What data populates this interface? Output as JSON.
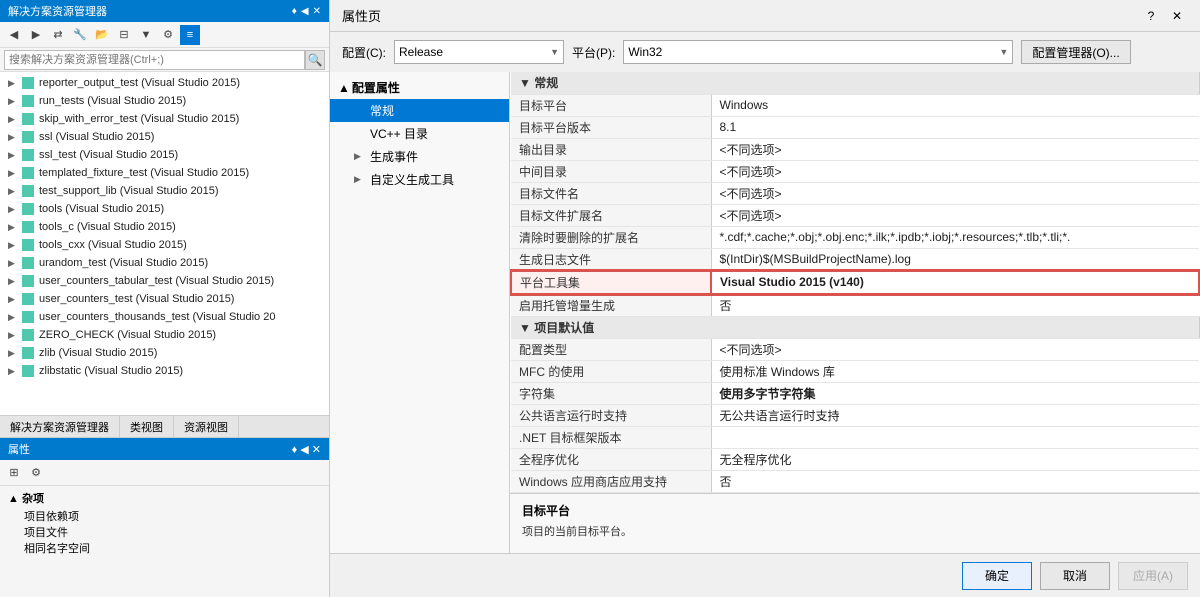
{
  "leftPanel": {
    "title": "解决方案资源管理器",
    "pinLabel": "♦",
    "autoHideLabel": "◀",
    "closeLabel": "✕",
    "searchPlaceholder": "搜索解决方案资源管理器(Ctrl+;)",
    "treeItems": [
      {
        "label": "reporter_output_test (Visual Studio 2015)",
        "indent": 0,
        "hasExpander": true,
        "expanded": false
      },
      {
        "label": "run_tests (Visual Studio 2015)",
        "indent": 0,
        "hasExpander": true,
        "expanded": false
      },
      {
        "label": "skip_with_error_test (Visual Studio 2015)",
        "indent": 0,
        "hasExpander": true,
        "expanded": false
      },
      {
        "label": "ssl (Visual Studio 2015)",
        "indent": 0,
        "hasExpander": true,
        "expanded": false
      },
      {
        "label": "ssl_test (Visual Studio 2015)",
        "indent": 0,
        "hasExpander": true,
        "expanded": false
      },
      {
        "label": "templated_fixture_test (Visual Studio 2015)",
        "indent": 0,
        "hasExpander": true,
        "expanded": false
      },
      {
        "label": "test_support_lib (Visual Studio 2015)",
        "indent": 0,
        "hasExpander": true,
        "expanded": false
      },
      {
        "label": "tools (Visual Studio 2015)",
        "indent": 0,
        "hasExpander": true,
        "expanded": false
      },
      {
        "label": "tools_c (Visual Studio 2015)",
        "indent": 0,
        "hasExpander": true,
        "expanded": false
      },
      {
        "label": "tools_cxx (Visual Studio 2015)",
        "indent": 0,
        "hasExpander": true,
        "expanded": false
      },
      {
        "label": "urandom_test (Visual Studio 2015)",
        "indent": 0,
        "hasExpander": true,
        "expanded": false
      },
      {
        "label": "user_counters_tabular_test (Visual Studio 2015)",
        "indent": 0,
        "hasExpander": true,
        "expanded": false
      },
      {
        "label": "user_counters_test (Visual Studio 2015)",
        "indent": 0,
        "hasExpander": true,
        "expanded": false
      },
      {
        "label": "user_counters_thousands_test (Visual Studio 20",
        "indent": 0,
        "hasExpander": true,
        "expanded": false
      },
      {
        "label": "ZERO_CHECK (Visual Studio 2015)",
        "indent": 0,
        "hasExpander": true,
        "expanded": false
      },
      {
        "label": "zlib (Visual Studio 2015)",
        "indent": 0,
        "hasExpander": true,
        "expanded": false
      },
      {
        "label": "zlibstatic (Visual Studio 2015)",
        "indent": 0,
        "hasExpander": true,
        "expanded": false
      }
    ],
    "bottomTabs": [
      "解决方案资源管理器",
      "类视图",
      "资源视图"
    ],
    "propertiesTitle": "属性",
    "propToolbarBtns": [
      "⊞",
      "⚙"
    ],
    "propSections": [
      {
        "label": "杂项",
        "items": [
          "项目依赖项",
          "项目文件",
          "相同名字空间"
        ]
      }
    ]
  },
  "dialog": {
    "title": "属性页",
    "helpLabel": "?",
    "closeLabel": "✕",
    "configLabel": "配置(C):",
    "configValue": "Release",
    "platformLabel": "平台(P):",
    "platformValue": "Win32",
    "configMgrLabel": "配置管理器(O)...",
    "configTree": [
      {
        "label": "▲ 配置属性",
        "isSection": true,
        "expanded": true
      },
      {
        "label": "常规",
        "indent": 1,
        "selected": true
      },
      {
        "label": "VC++ 目录",
        "indent": 1,
        "selected": false
      },
      {
        "label": "▶ 生成事件",
        "indent": 1,
        "hasExpander": true,
        "selected": false
      },
      {
        "label": "▶ 自定义生成工具",
        "indent": 1,
        "hasExpander": true,
        "selected": false
      }
    ],
    "sections": [
      {
        "label": "▼ 常规",
        "isHeader": true,
        "rows": [
          {
            "name": "目标平台",
            "value": "Windows",
            "valueClass": "gray-text",
            "highlighted": false
          },
          {
            "name": "目标平台版本",
            "value": "8.1",
            "valueClass": "",
            "highlighted": false
          },
          {
            "name": "输出目录",
            "value": "<不同选项>",
            "valueClass": "gray-text",
            "highlighted": false
          },
          {
            "name": "中间目录",
            "value": "<不同选项>",
            "valueClass": "gray-text",
            "highlighted": false
          },
          {
            "name": "目标文件名",
            "value": "<不同选项>",
            "valueClass": "gray-text",
            "highlighted": false
          },
          {
            "name": "目标文件扩展名",
            "value": "<不同选项>",
            "valueClass": "gray-text",
            "highlighted": false
          },
          {
            "name": "清除时要删除的扩展名",
            "value": "*.cdf;*.cache;*.obj;*.obj.enc;*.ilk;*.ipdb;*.iobj;*.resources;*.tlb;*.tli;*.",
            "valueClass": "",
            "highlighted": false
          },
          {
            "name": "生成日志文件",
            "value": "$(IntDir)$(MSBuildProjectName).log",
            "valueClass": "",
            "highlighted": false
          },
          {
            "name": "平台工具集",
            "value": "Visual Studio 2015 (v140)",
            "valueClass": "bold-text",
            "highlighted": true
          },
          {
            "name": "启用托管增量生成",
            "value": "否",
            "valueClass": "",
            "highlighted": false
          }
        ]
      },
      {
        "label": "▼ 项目默认值",
        "isHeader": true,
        "rows": [
          {
            "name": "配置类型",
            "value": "<不同选项>",
            "valueClass": "gray-text",
            "highlighted": false
          },
          {
            "name": "MFC 的使用",
            "value": "使用标准 Windows 库",
            "valueClass": "",
            "highlighted": false
          },
          {
            "name": "字符集",
            "value": "使用多字节字符集",
            "valueClass": "bold-text",
            "highlighted": false
          },
          {
            "name": "公共语言运行时支持",
            "value": "无公共语言运行时支持",
            "valueClass": "",
            "highlighted": false
          },
          {
            "name": ".NET 目标框架版本",
            "value": "",
            "valueClass": "blue-text",
            "highlighted": false
          },
          {
            "name": "全程序优化",
            "value": "无全程序优化",
            "valueClass": "",
            "highlighted": false
          },
          {
            "name": "Windows 应用商店应用支持",
            "value": "否",
            "valueClass": "",
            "highlighted": false
          }
        ]
      }
    ],
    "descriptionTitle": "目标平台",
    "descriptionText": "项目的当前目标平台。",
    "buttons": {
      "ok": "确定",
      "cancel": "取消",
      "apply": "应用(A)"
    }
  }
}
